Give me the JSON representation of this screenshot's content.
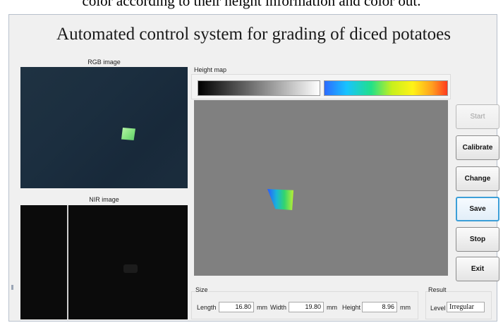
{
  "caption": "color according to their height information and color out.",
  "window": {
    "title": "Automated control system for grading of diced potatoes"
  },
  "images": {
    "rgb_label": "RGB image",
    "nir_label": "NIR image",
    "height_map_label": "Height map"
  },
  "buttons": {
    "start": "Start",
    "calibrate": "Calibrate",
    "change": "Change",
    "save": "Save",
    "stop": "Stop",
    "exit": "Exit"
  },
  "size": {
    "group_label": "Size",
    "length_label": "Length",
    "length_value": "16.80",
    "length_unit": "mm",
    "width_label": "Width",
    "width_value": "19.80",
    "width_unit": "mm",
    "height_label": "Height",
    "height_value": "8.96",
    "height_unit": "mm"
  },
  "result": {
    "group_label": "Result",
    "level_label": "Level",
    "level_value": "Irregular"
  }
}
